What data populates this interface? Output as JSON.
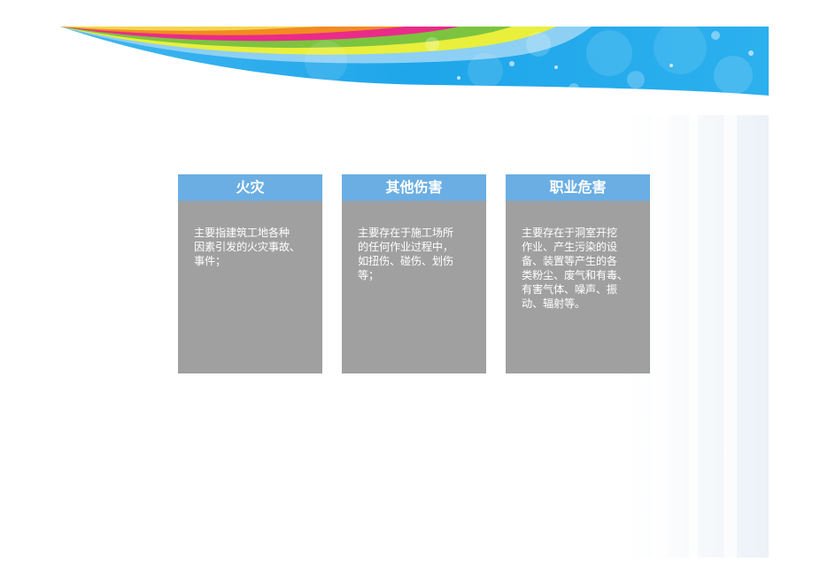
{
  "cards": [
    {
      "title": "火灾",
      "body": "主要指建筑工地各种\n因素引发的火灾事故、\n事件；"
    },
    {
      "title": "其他伤害",
      "body": "主要存在于施工场所\n的任何作业过程中，\n如扭伤、碰伤、划伤\n等；"
    },
    {
      "title": "职业危害",
      "body": "主要存在于洞室开挖\n作业、产生污染的设\n备、装置等产生的各\n类粉尘、废气和有毒、\n有害气体、噪声、振\n动、辐射等。"
    }
  ],
  "colors": {
    "header": "#6aaee3",
    "card_body": "#a0a0a0",
    "text": "#ffffff",
    "banner_blue": "#1aa3e6"
  }
}
